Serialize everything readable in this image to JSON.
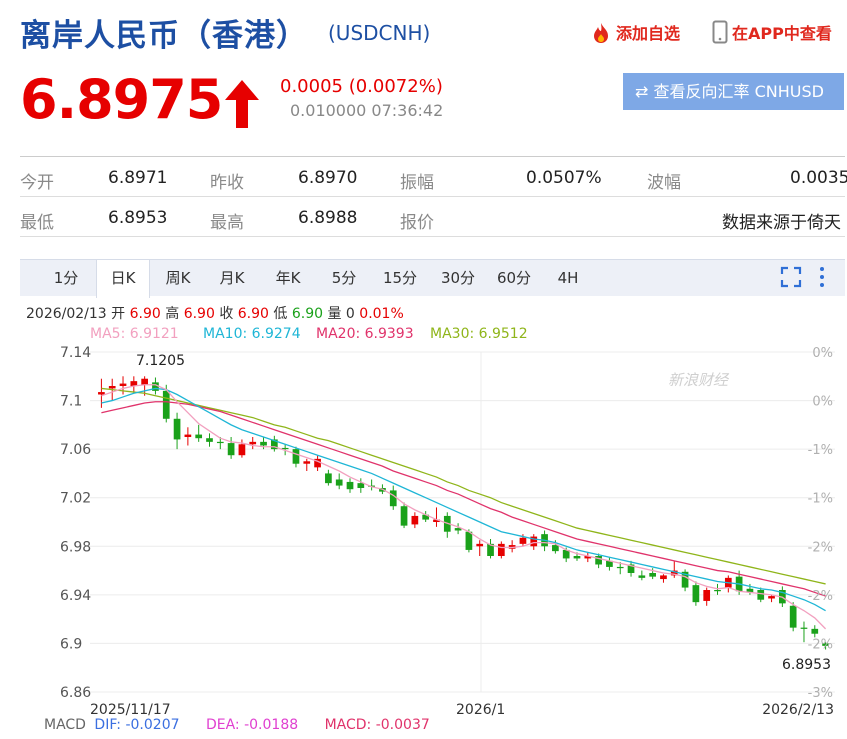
{
  "header": {
    "title": "离岸人民币（香港）",
    "code": "(USDCNH)",
    "add_watchlist": "添加自选",
    "view_in_app": "在APP中查看"
  },
  "quote": {
    "price": "6.8975",
    "change": "0.0005 (0.0072%)",
    "subline": "0.010000 07:36:42",
    "reverse_button": "查看反向汇率 CNHUSD"
  },
  "stats": {
    "row1": [
      {
        "label": "今开",
        "value": "6.8971"
      },
      {
        "label": "昨收",
        "value": "6.8970"
      },
      {
        "label": "振幅",
        "value": "0.0507%"
      },
      {
        "label": "波幅",
        "value": "0.0035"
      }
    ],
    "row2": [
      {
        "label": "最低",
        "value": "6.8953"
      },
      {
        "label": "最高",
        "value": "6.8988"
      },
      {
        "label": "报价",
        "value": "数据来源于倚天"
      }
    ]
  },
  "tabs": [
    "1分",
    "日K",
    "周K",
    "月K",
    "年K",
    "5分",
    "15分",
    "30分",
    "60分",
    "4H"
  ],
  "active_tab": "日K",
  "ohlc_info": {
    "date": "2026/02/13",
    "open_label": "开",
    "open": "6.90",
    "high_label": "高",
    "high": "6.90",
    "close_label": "收",
    "close": "6.90",
    "low_label": "低",
    "low": "6.90",
    "vol_label": "量",
    "vol": "0",
    "pct": "0.01%"
  },
  "ma": {
    "ma5": "MA5: 6.9121",
    "ma10": "MA10: 6.9274",
    "ma20": "MA20: 6.9393",
    "ma30": "MA30: 6.9512"
  },
  "macd": {
    "label": "MACD",
    "dif": "DIF: -0.0207",
    "dea": "DEA: -0.0188",
    "macd": "MACD: -0.0037"
  },
  "watermark": "新浪财经",
  "colors": {
    "up": "#e60000",
    "down": "#1aa11a",
    "ma5": "#f2a0bf",
    "ma10": "#1fb6d6",
    "ma20": "#e0336b",
    "ma30": "#8fb51a",
    "brand_blue": "#1d4fa3"
  },
  "chart_data": {
    "type": "candlestick",
    "y_ticks": [
      "7.14",
      "7.1",
      "7.06",
      "7.02",
      "6.98",
      "6.94",
      "6.9",
      "6.86"
    ],
    "right_ticks": [
      "0%",
      "0%",
      "-1%",
      "-1%",
      "-2%",
      "-2%",
      "-2%",
      "-3%"
    ],
    "x_labels": [
      "2025/11/17",
      "2026/1",
      "2026/2/13"
    ],
    "max_label": "7.1205",
    "min_label": "6.8953",
    "ylim": [
      6.86,
      7.14
    ],
    "candles": [
      {
        "o": 7.105,
        "h": 7.118,
        "l": 7.094,
        "c": 7.107
      },
      {
        "o": 7.11,
        "h": 7.118,
        "l": 7.1,
        "c": 7.112
      },
      {
        "o": 7.112,
        "h": 7.12,
        "l": 7.105,
        "c": 7.114
      },
      {
        "o": 7.112,
        "h": 7.12,
        "l": 7.106,
        "c": 7.116
      },
      {
        "o": 7.113,
        "h": 7.12,
        "l": 7.104,
        "c": 7.118
      },
      {
        "o": 7.115,
        "h": 7.119,
        "l": 7.105,
        "c": 7.108
      },
      {
        "o": 7.108,
        "h": 7.113,
        "l": 7.082,
        "c": 7.085
      },
      {
        "o": 7.085,
        "h": 7.09,
        "l": 7.06,
        "c": 7.068
      },
      {
        "o": 7.07,
        "h": 7.078,
        "l": 7.063,
        "c": 7.072
      },
      {
        "o": 7.072,
        "h": 7.08,
        "l": 7.066,
        "c": 7.069
      },
      {
        "o": 7.069,
        "h": 7.073,
        "l": 7.062,
        "c": 7.066
      },
      {
        "o": 7.066,
        "h": 7.07,
        "l": 7.06,
        "c": 7.065
      },
      {
        "o": 7.065,
        "h": 7.07,
        "l": 7.052,
        "c": 7.055
      },
      {
        "o": 7.055,
        "h": 7.068,
        "l": 7.053,
        "c": 7.064
      },
      {
        "o": 7.064,
        "h": 7.07,
        "l": 7.06,
        "c": 7.066
      },
      {
        "o": 7.066,
        "h": 7.07,
        "l": 7.06,
        "c": 7.063
      },
      {
        "o": 7.068,
        "h": 7.071,
        "l": 7.058,
        "c": 7.06
      },
      {
        "o": 7.061,
        "h": 7.064,
        "l": 7.055,
        "c": 7.06
      },
      {
        "o": 7.06,
        "h": 7.062,
        "l": 7.045,
        "c": 7.048
      },
      {
        "o": 7.048,
        "h": 7.052,
        "l": 7.042,
        "c": 7.05
      },
      {
        "o": 7.045,
        "h": 7.055,
        "l": 7.042,
        "c": 7.052
      },
      {
        "o": 7.04,
        "h": 7.043,
        "l": 7.03,
        "c": 7.032
      },
      {
        "o": 7.035,
        "h": 7.04,
        "l": 7.027,
        "c": 7.03
      },
      {
        "o": 7.033,
        "h": 7.036,
        "l": 7.024,
        "c": 7.027
      },
      {
        "o": 7.032,
        "h": 7.036,
        "l": 7.024,
        "c": 7.028
      },
      {
        "o": 7.03,
        "h": 7.035,
        "l": 7.026,
        "c": 7.029
      },
      {
        "o": 7.028,
        "h": 7.031,
        "l": 7.023,
        "c": 7.025
      },
      {
        "o": 7.026,
        "h": 7.03,
        "l": 7.01,
        "c": 7.013
      },
      {
        "o": 7.013,
        "h": 7.016,
        "l": 6.995,
        "c": 6.997
      },
      {
        "o": 6.998,
        "h": 7.008,
        "l": 6.995,
        "c": 7.005
      },
      {
        "o": 7.006,
        "h": 7.009,
        "l": 7.0,
        "c": 7.002
      },
      {
        "o": 7.0,
        "h": 7.012,
        "l": 6.996,
        "c": 7.002
      },
      {
        "o": 7.005,
        "h": 7.008,
        "l": 6.987,
        "c": 6.992
      },
      {
        "o": 6.995,
        "h": 6.999,
        "l": 6.99,
        "c": 6.993
      },
      {
        "o": 6.992,
        "h": 6.994,
        "l": 6.975,
        "c": 6.977
      },
      {
        "o": 6.98,
        "h": 6.985,
        "l": 6.972,
        "c": 6.982
      },
      {
        "o": 6.982,
        "h": 6.986,
        "l": 6.97,
        "c": 6.972
      },
      {
        "o": 6.972,
        "h": 6.984,
        "l": 6.97,
        "c": 6.982
      },
      {
        "o": 6.978,
        "h": 6.985,
        "l": 6.975,
        "c": 6.981
      },
      {
        "o": 6.982,
        "h": 6.99,
        "l": 6.98,
        "c": 6.987
      },
      {
        "o": 6.98,
        "h": 6.99,
        "l": 6.977,
        "c": 6.988
      },
      {
        "o": 6.99,
        "h": 6.993,
        "l": 6.976,
        "c": 6.98
      },
      {
        "o": 6.981,
        "h": 6.985,
        "l": 6.974,
        "c": 6.976
      },
      {
        "o": 6.977,
        "h": 6.979,
        "l": 6.967,
        "c": 6.97
      },
      {
        "o": 6.972,
        "h": 6.975,
        "l": 6.968,
        "c": 6.97
      },
      {
        "o": 6.97,
        "h": 6.975,
        "l": 6.967,
        "c": 6.972
      },
      {
        "o": 6.972,
        "h": 6.974,
        "l": 6.962,
        "c": 6.965
      },
      {
        "o": 6.968,
        "h": 6.971,
        "l": 6.96,
        "c": 6.963
      },
      {
        "o": 6.963,
        "h": 6.967,
        "l": 6.957,
        "c": 6.962
      },
      {
        "o": 6.965,
        "h": 6.968,
        "l": 6.955,
        "c": 6.958
      },
      {
        "o": 6.956,
        "h": 6.96,
        "l": 6.952,
        "c": 6.954
      },
      {
        "o": 6.958,
        "h": 6.962,
        "l": 6.953,
        "c": 6.955
      },
      {
        "o": 6.953,
        "h": 6.957,
        "l": 6.95,
        "c": 6.956
      },
      {
        "o": 6.956,
        "h": 6.968,
        "l": 6.954,
        "c": 6.96
      },
      {
        "o": 6.959,
        "h": 6.961,
        "l": 6.943,
        "c": 6.946
      },
      {
        "o": 6.948,
        "h": 6.951,
        "l": 6.931,
        "c": 6.934
      },
      {
        "o": 6.935,
        "h": 6.946,
        "l": 6.931,
        "c": 6.944
      },
      {
        "o": 6.944,
        "h": 6.949,
        "l": 6.94,
        "c": 6.943
      },
      {
        "o": 6.946,
        "h": 6.956,
        "l": 6.942,
        "c": 6.954
      },
      {
        "o": 6.955,
        "h": 6.96,
        "l": 6.94,
        "c": 6.943
      },
      {
        "o": 6.945,
        "h": 6.949,
        "l": 6.94,
        "c": 6.942
      },
      {
        "o": 6.944,
        "h": 6.946,
        "l": 6.934,
        "c": 6.936
      },
      {
        "o": 6.937,
        "h": 6.94,
        "l": 6.934,
        "c": 6.939
      },
      {
        "o": 6.944,
        "h": 6.947,
        "l": 6.93,
        "c": 6.933
      },
      {
        "o": 6.931,
        "h": 6.934,
        "l": 6.91,
        "c": 6.913
      },
      {
        "o": 6.913,
        "h": 6.918,
        "l": 6.901,
        "c": 6.912
      },
      {
        "o": 6.912,
        "h": 6.915,
        "l": 6.905,
        "c": 6.908
      },
      {
        "o": 6.9,
        "h": 6.901,
        "l": 6.895,
        "c": 6.898
      }
    ],
    "ma5": [
      7.104,
      7.107,
      7.11,
      7.112,
      7.113,
      7.113,
      7.109,
      7.099,
      7.09,
      7.081,
      7.075,
      7.069,
      7.066,
      7.065,
      7.063,
      7.062,
      7.062,
      7.059,
      7.056,
      7.053,
      7.05,
      7.046,
      7.042,
      7.037,
      7.033,
      7.029,
      7.027,
      7.022,
      7.015,
      7.01,
      7.006,
      7.002,
      6.999,
      6.996,
      6.992,
      6.986,
      6.981,
      6.979,
      6.979,
      6.98,
      6.983,
      6.983,
      6.982,
      6.977,
      6.974,
      6.972,
      6.97,
      6.968,
      6.966,
      6.964,
      6.962,
      6.96,
      6.958,
      6.957,
      6.955,
      6.95,
      6.947,
      6.945,
      6.946,
      6.943,
      6.942,
      6.941,
      6.94,
      6.938,
      6.932,
      6.927,
      6.921,
      6.912
    ],
    "ma10": [
      7.098,
      7.1,
      7.103,
      7.106,
      7.108,
      7.11,
      7.109,
      7.105,
      7.1,
      7.095,
      7.09,
      7.085,
      7.08,
      7.076,
      7.073,
      7.07,
      7.067,
      7.064,
      7.061,
      7.058,
      7.055,
      7.052,
      7.049,
      7.046,
      7.043,
      7.04,
      7.036,
      7.032,
      7.028,
      7.024,
      7.02,
      7.016,
      7.012,
      7.008,
      7.004,
      7.0,
      6.996,
      6.992,
      6.99,
      6.988,
      6.986,
      6.985,
      6.983,
      6.98,
      6.977,
      6.975,
      6.973,
      6.971,
      6.969,
      6.967,
      6.965,
      6.963,
      6.961,
      6.959,
      6.957,
      6.955,
      6.953,
      6.951,
      6.95,
      6.949,
      6.947,
      6.945,
      6.944,
      6.942,
      6.939,
      6.936,
      6.932,
      6.927
    ],
    "ma20": [
      7.09,
      7.092,
      7.094,
      7.096,
      7.098,
      7.099,
      7.099,
      7.098,
      7.097,
      7.095,
      7.093,
      7.091,
      7.088,
      7.085,
      7.082,
      7.079,
      7.076,
      7.073,
      7.07,
      7.067,
      7.064,
      7.061,
      7.058,
      7.055,
      7.052,
      7.049,
      7.046,
      7.042,
      7.039,
      7.036,
      7.033,
      7.03,
      7.026,
      7.023,
      7.019,
      7.015,
      7.011,
      7.008,
      7.004,
      7.001,
      6.998,
      6.995,
      6.992,
      6.989,
      6.986,
      6.984,
      6.982,
      6.98,
      6.978,
      6.976,
      6.974,
      6.972,
      6.97,
      6.968,
      6.966,
      6.964,
      6.962,
      6.96,
      6.959,
      6.957,
      6.955,
      6.953,
      6.951,
      6.949,
      6.947,
      6.945,
      6.942,
      6.939
    ],
    "ma30": [
      7.11,
      7.109,
      7.108,
      7.107,
      7.106,
      7.104,
      7.102,
      7.1,
      7.098,
      7.096,
      7.094,
      7.092,
      7.09,
      7.088,
      7.086,
      7.083,
      7.08,
      7.078,
      7.075,
      7.072,
      7.069,
      7.067,
      7.064,
      7.061,
      7.058,
      7.055,
      7.052,
      7.049,
      7.046,
      7.043,
      7.04,
      7.037,
      7.033,
      7.03,
      7.026,
      7.023,
      7.02,
      7.016,
      7.013,
      7.01,
      7.007,
      7.004,
      7.001,
      6.998,
      6.995,
      6.993,
      6.991,
      6.989,
      6.987,
      6.985,
      6.983,
      6.981,
      6.979,
      6.977,
      6.975,
      6.973,
      6.971,
      6.969,
      6.967,
      6.965,
      6.963,
      6.961,
      6.959,
      6.957,
      6.955,
      6.953,
      6.951,
      6.949
    ]
  }
}
